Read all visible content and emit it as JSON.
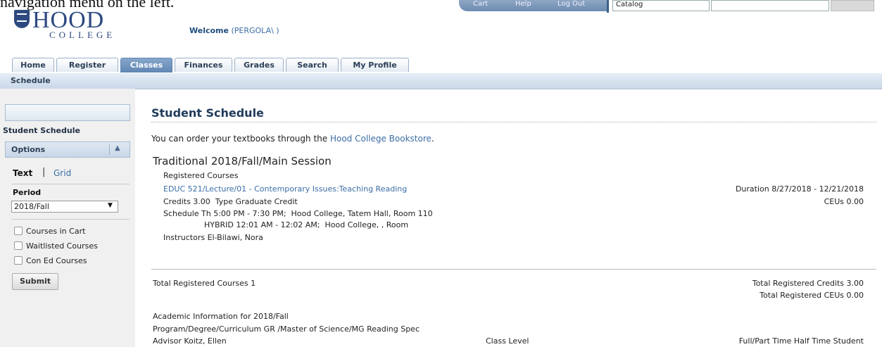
{
  "overlay": {
    "caption": "navigation menu on the left."
  },
  "utility_bar": {
    "links": [
      "Cart",
      "Help",
      "Log Out"
    ],
    "catalog_select": "Catalog",
    "keyword_input": "",
    "go_button": ""
  },
  "logo": {
    "name": "HOOD",
    "sub": "COLLEGE"
  },
  "welcome": {
    "label": "Welcome",
    "user": "(PERGOLA\\    )"
  },
  "tabs": [
    "Home",
    "Register",
    "Classes",
    "Finances",
    "Grades",
    "Search",
    "My Profile"
  ],
  "active_tab": "Classes",
  "subnav": {
    "label": "Schedule"
  },
  "sidebar": {
    "title": "Student Schedule",
    "options_label": "Options",
    "view_text": "Text",
    "view_grid": "Grid",
    "period_label": "Period",
    "period_value": "2018/Fall",
    "checkboxes": [
      "Courses in Cart",
      "Waitlisted Courses",
      "Con Ed Courses"
    ],
    "submit_label": "Submit"
  },
  "main": {
    "title": "Student Schedule",
    "intro_prefix": "You can order your textbooks through the ",
    "intro_link": "Hood College Bookstore",
    "intro_suffix": ".",
    "term": "Traditional 2018/Fall/Main Session",
    "registered_heading": "Registered Courses",
    "course_link": "EDUC 521/Lecture/01 - Contemporary Issues:Teaching Reading",
    "duration": "Duration 8/27/2018 - 12/21/2018",
    "ceus": "CEUs 0.00",
    "credits_line": "Credits 3.00  Type Graduate Credit",
    "schedule_line1": "Schedule Th 5:00 PM - 7:30 PM;  Hood College, Tatem Hall, Room 110",
    "schedule_line2": "HYBRID 12:01 AM - 12:02 AM;  Hood College, , Room",
    "instructors": "Instructors El-Bilawi, Nora",
    "total_courses": "Total Registered Courses 1",
    "total_credits": "Total Registered Credits 3.00",
    "total_ceus": "Total Registered CEUs 0.00",
    "academic_heading": "Academic Information for 2018/Fall",
    "program_line": "Program/Degree/Curriculum GR /Master of Science/MG Reading Spec",
    "advisor": "Advisor Koitz, Ellen",
    "class_level": "Class Level",
    "full_part": "Full/Part Time Half Time Student"
  }
}
